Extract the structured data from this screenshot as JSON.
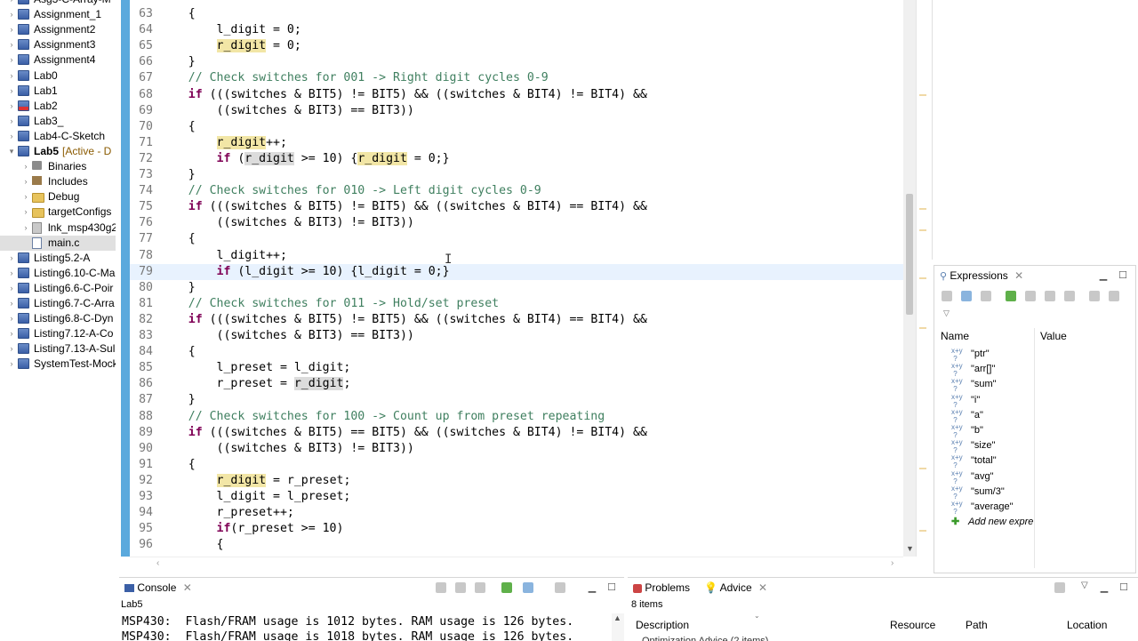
{
  "explorer": {
    "items": [
      {
        "label": "Asg3-C-Array-M",
        "indent": 0,
        "icon": "project"
      },
      {
        "label": "Assignment_1",
        "indent": 0,
        "icon": "project"
      },
      {
        "label": "Assignment2",
        "indent": 0,
        "icon": "project"
      },
      {
        "label": "Assignment3",
        "indent": 0,
        "icon": "project"
      },
      {
        "label": "Assignment4",
        "indent": 0,
        "icon": "project"
      },
      {
        "label": "Lab0",
        "indent": 0,
        "icon": "project"
      },
      {
        "label": "Lab1",
        "indent": 0,
        "icon": "project"
      },
      {
        "label": "Lab2",
        "indent": 0,
        "icon": "project-error"
      },
      {
        "label": "Lab3_",
        "indent": 0,
        "icon": "project"
      },
      {
        "label": "Lab4-C-Sketch",
        "indent": 0,
        "icon": "project"
      },
      {
        "label": "Lab5",
        "active_tag": "[Active - D",
        "indent": 0,
        "icon": "project",
        "expanded": true
      },
      {
        "label": "Binaries",
        "indent": 1,
        "icon": "binaries"
      },
      {
        "label": "Includes",
        "indent": 1,
        "icon": "includes"
      },
      {
        "label": "Debug",
        "indent": 1,
        "icon": "folder"
      },
      {
        "label": "targetConfigs",
        "indent": 1,
        "icon": "folder"
      },
      {
        "label": "lnk_msp430g2",
        "indent": 1,
        "icon": "link-file"
      },
      {
        "label": "main.c",
        "indent": 1,
        "icon": "c-file",
        "selected": true
      },
      {
        "label": "Listing5.2-A",
        "indent": 0,
        "icon": "project"
      },
      {
        "label": "Listing6.10-C-Ma",
        "indent": 0,
        "icon": "project"
      },
      {
        "label": "Listing6.6-C-Poir",
        "indent": 0,
        "icon": "project"
      },
      {
        "label": "Listing6.7-C-Arra",
        "indent": 0,
        "icon": "project"
      },
      {
        "label": "Listing6.8-C-Dyn",
        "indent": 0,
        "icon": "project"
      },
      {
        "label": "Listing7.12-A-Co",
        "indent": 0,
        "icon": "project"
      },
      {
        "label": "Listing7.13-A-Sul",
        "indent": 0,
        "icon": "project"
      },
      {
        "label": "SystemTest-Mock",
        "indent": 0,
        "icon": "project"
      }
    ]
  },
  "editor": {
    "current_line": 79,
    "lines": [
      {
        "n": 63,
        "parts": [
          [
            "",
            "    {"
          ]
        ]
      },
      {
        "n": 64,
        "parts": [
          [
            "",
            "        l_digit = 0;"
          ]
        ]
      },
      {
        "n": 65,
        "parts": [
          [
            "",
            "        "
          ],
          [
            "hl",
            "r_digit"
          ],
          [
            "",
            " = 0;"
          ]
        ]
      },
      {
        "n": 66,
        "parts": [
          [
            "",
            "    }"
          ]
        ]
      },
      {
        "n": 67,
        "parts": [
          [
            "cm",
            "    // Check switches for 001 -> Right digit cycles 0-9"
          ]
        ]
      },
      {
        "n": 68,
        "parts": [
          [
            "kw",
            "    if"
          ],
          [
            "",
            " (((switches & BIT5) != BIT5) && ((switches & BIT4) != BIT4) &&"
          ]
        ]
      },
      {
        "n": 69,
        "parts": [
          [
            "",
            "        ((switches & BIT3) == BIT3))"
          ]
        ]
      },
      {
        "n": 70,
        "parts": [
          [
            "",
            "    {"
          ]
        ]
      },
      {
        "n": 71,
        "parts": [
          [
            "",
            "        "
          ],
          [
            "hl",
            "r_digit"
          ],
          [
            "",
            "++;"
          ]
        ]
      },
      {
        "n": 72,
        "parts": [
          [
            "kw",
            "        if"
          ],
          [
            "",
            " ("
          ],
          [
            "hl2",
            "r_digit"
          ],
          [
            "",
            " >= 10) {"
          ],
          [
            "hl",
            "r_digit"
          ],
          [
            "",
            " = 0;}"
          ]
        ]
      },
      {
        "n": 73,
        "parts": [
          [
            "",
            "    }"
          ]
        ]
      },
      {
        "n": 74,
        "parts": [
          [
            "cm",
            "    // Check switches for 010 -> Left digit cycles 0-9"
          ]
        ]
      },
      {
        "n": 75,
        "parts": [
          [
            "kw",
            "    if"
          ],
          [
            "",
            " (((switches & BIT5) != BIT5) && ((switches & BIT4) == BIT4) &&"
          ]
        ]
      },
      {
        "n": 76,
        "parts": [
          [
            "",
            "        ((switches & BIT3) != BIT3))"
          ]
        ]
      },
      {
        "n": 77,
        "parts": [
          [
            "",
            "    {"
          ]
        ]
      },
      {
        "n": 78,
        "parts": [
          [
            "",
            "        l_digit++;"
          ]
        ]
      },
      {
        "n": 79,
        "parts": [
          [
            "kw",
            "        if"
          ],
          [
            "",
            " (l_digit >= 10) {l_digit = 0;}"
          ]
        ]
      },
      {
        "n": 80,
        "parts": [
          [
            "",
            "    }"
          ]
        ]
      },
      {
        "n": 81,
        "parts": [
          [
            "cm",
            "    // Check switches for 011 -> Hold/set preset"
          ]
        ]
      },
      {
        "n": 82,
        "parts": [
          [
            "kw",
            "    if"
          ],
          [
            "",
            " (((switches & BIT5) != BIT5) && ((switches & BIT4) == BIT4) &&"
          ]
        ]
      },
      {
        "n": 83,
        "parts": [
          [
            "",
            "        ((switches & BIT3) == BIT3))"
          ]
        ]
      },
      {
        "n": 84,
        "parts": [
          [
            "",
            "    {"
          ]
        ]
      },
      {
        "n": 85,
        "parts": [
          [
            "",
            "        l_preset = l_digit;"
          ]
        ]
      },
      {
        "n": 86,
        "parts": [
          [
            "",
            "        r_preset = "
          ],
          [
            "hl2",
            "r_digit"
          ],
          [
            "",
            ";"
          ]
        ]
      },
      {
        "n": 87,
        "parts": [
          [
            "",
            "    }"
          ]
        ]
      },
      {
        "n": 88,
        "parts": [
          [
            "cm",
            "    // Check switches for 100 -> Count up from preset repeating"
          ]
        ]
      },
      {
        "n": 89,
        "parts": [
          [
            "kw",
            "    if"
          ],
          [
            "",
            " (((switches & BIT5) == BIT5) && ((switches & BIT4) != BIT4) &&"
          ]
        ]
      },
      {
        "n": 90,
        "parts": [
          [
            "",
            "        ((switches & BIT3) != BIT3))"
          ]
        ]
      },
      {
        "n": 91,
        "parts": [
          [
            "",
            "    {"
          ]
        ]
      },
      {
        "n": 92,
        "parts": [
          [
            "",
            "        "
          ],
          [
            "hl",
            "r_digit"
          ],
          [
            "",
            " = r_preset;"
          ]
        ]
      },
      {
        "n": 93,
        "parts": [
          [
            "",
            "        l_digit = l_preset;"
          ]
        ]
      },
      {
        "n": 94,
        "parts": [
          [
            "",
            "        r_preset++;"
          ]
        ]
      },
      {
        "n": 95,
        "parts": [
          [
            "kw",
            "        if"
          ],
          [
            "",
            "(r_preset >= 10)"
          ]
        ]
      },
      {
        "n": 96,
        "parts": [
          [
            "",
            "        {"
          ]
        ]
      }
    ]
  },
  "expressions": {
    "tab_label": "Expressions",
    "col_name": "Name",
    "col_value": "Value",
    "items": [
      "\"ptr\"",
      "\"arr[]\"",
      "\"sum\"",
      "\"i\"",
      "\"a\"",
      "\"b\"",
      "\"size\"",
      "\"total\"",
      "\"avg\"",
      "\"sum/3\"",
      "\"average\""
    ],
    "add_new": "Add new expre"
  },
  "console": {
    "tab_label": "Console",
    "project": "Lab5",
    "lines": [
      "MSP430:  Flash/FRAM usage is 1012 bytes. RAM usage is 126 bytes.",
      "MSP430:  Flash/FRAM usage is 1018 bytes. RAM usage is 126 bytes."
    ]
  },
  "advice": {
    "tab_problems": "Problems",
    "tab_advice": "Advice",
    "count": "8 items",
    "columns": [
      "Description",
      "Resource",
      "Path",
      "Location"
    ],
    "first_row": "Optimization Advice (2 items)"
  },
  "colors": {
    "keyword": "#7f0055",
    "comment": "#3f7f5f",
    "occurrence": "#f2e6a6",
    "ruler": "#5aa9dd"
  }
}
